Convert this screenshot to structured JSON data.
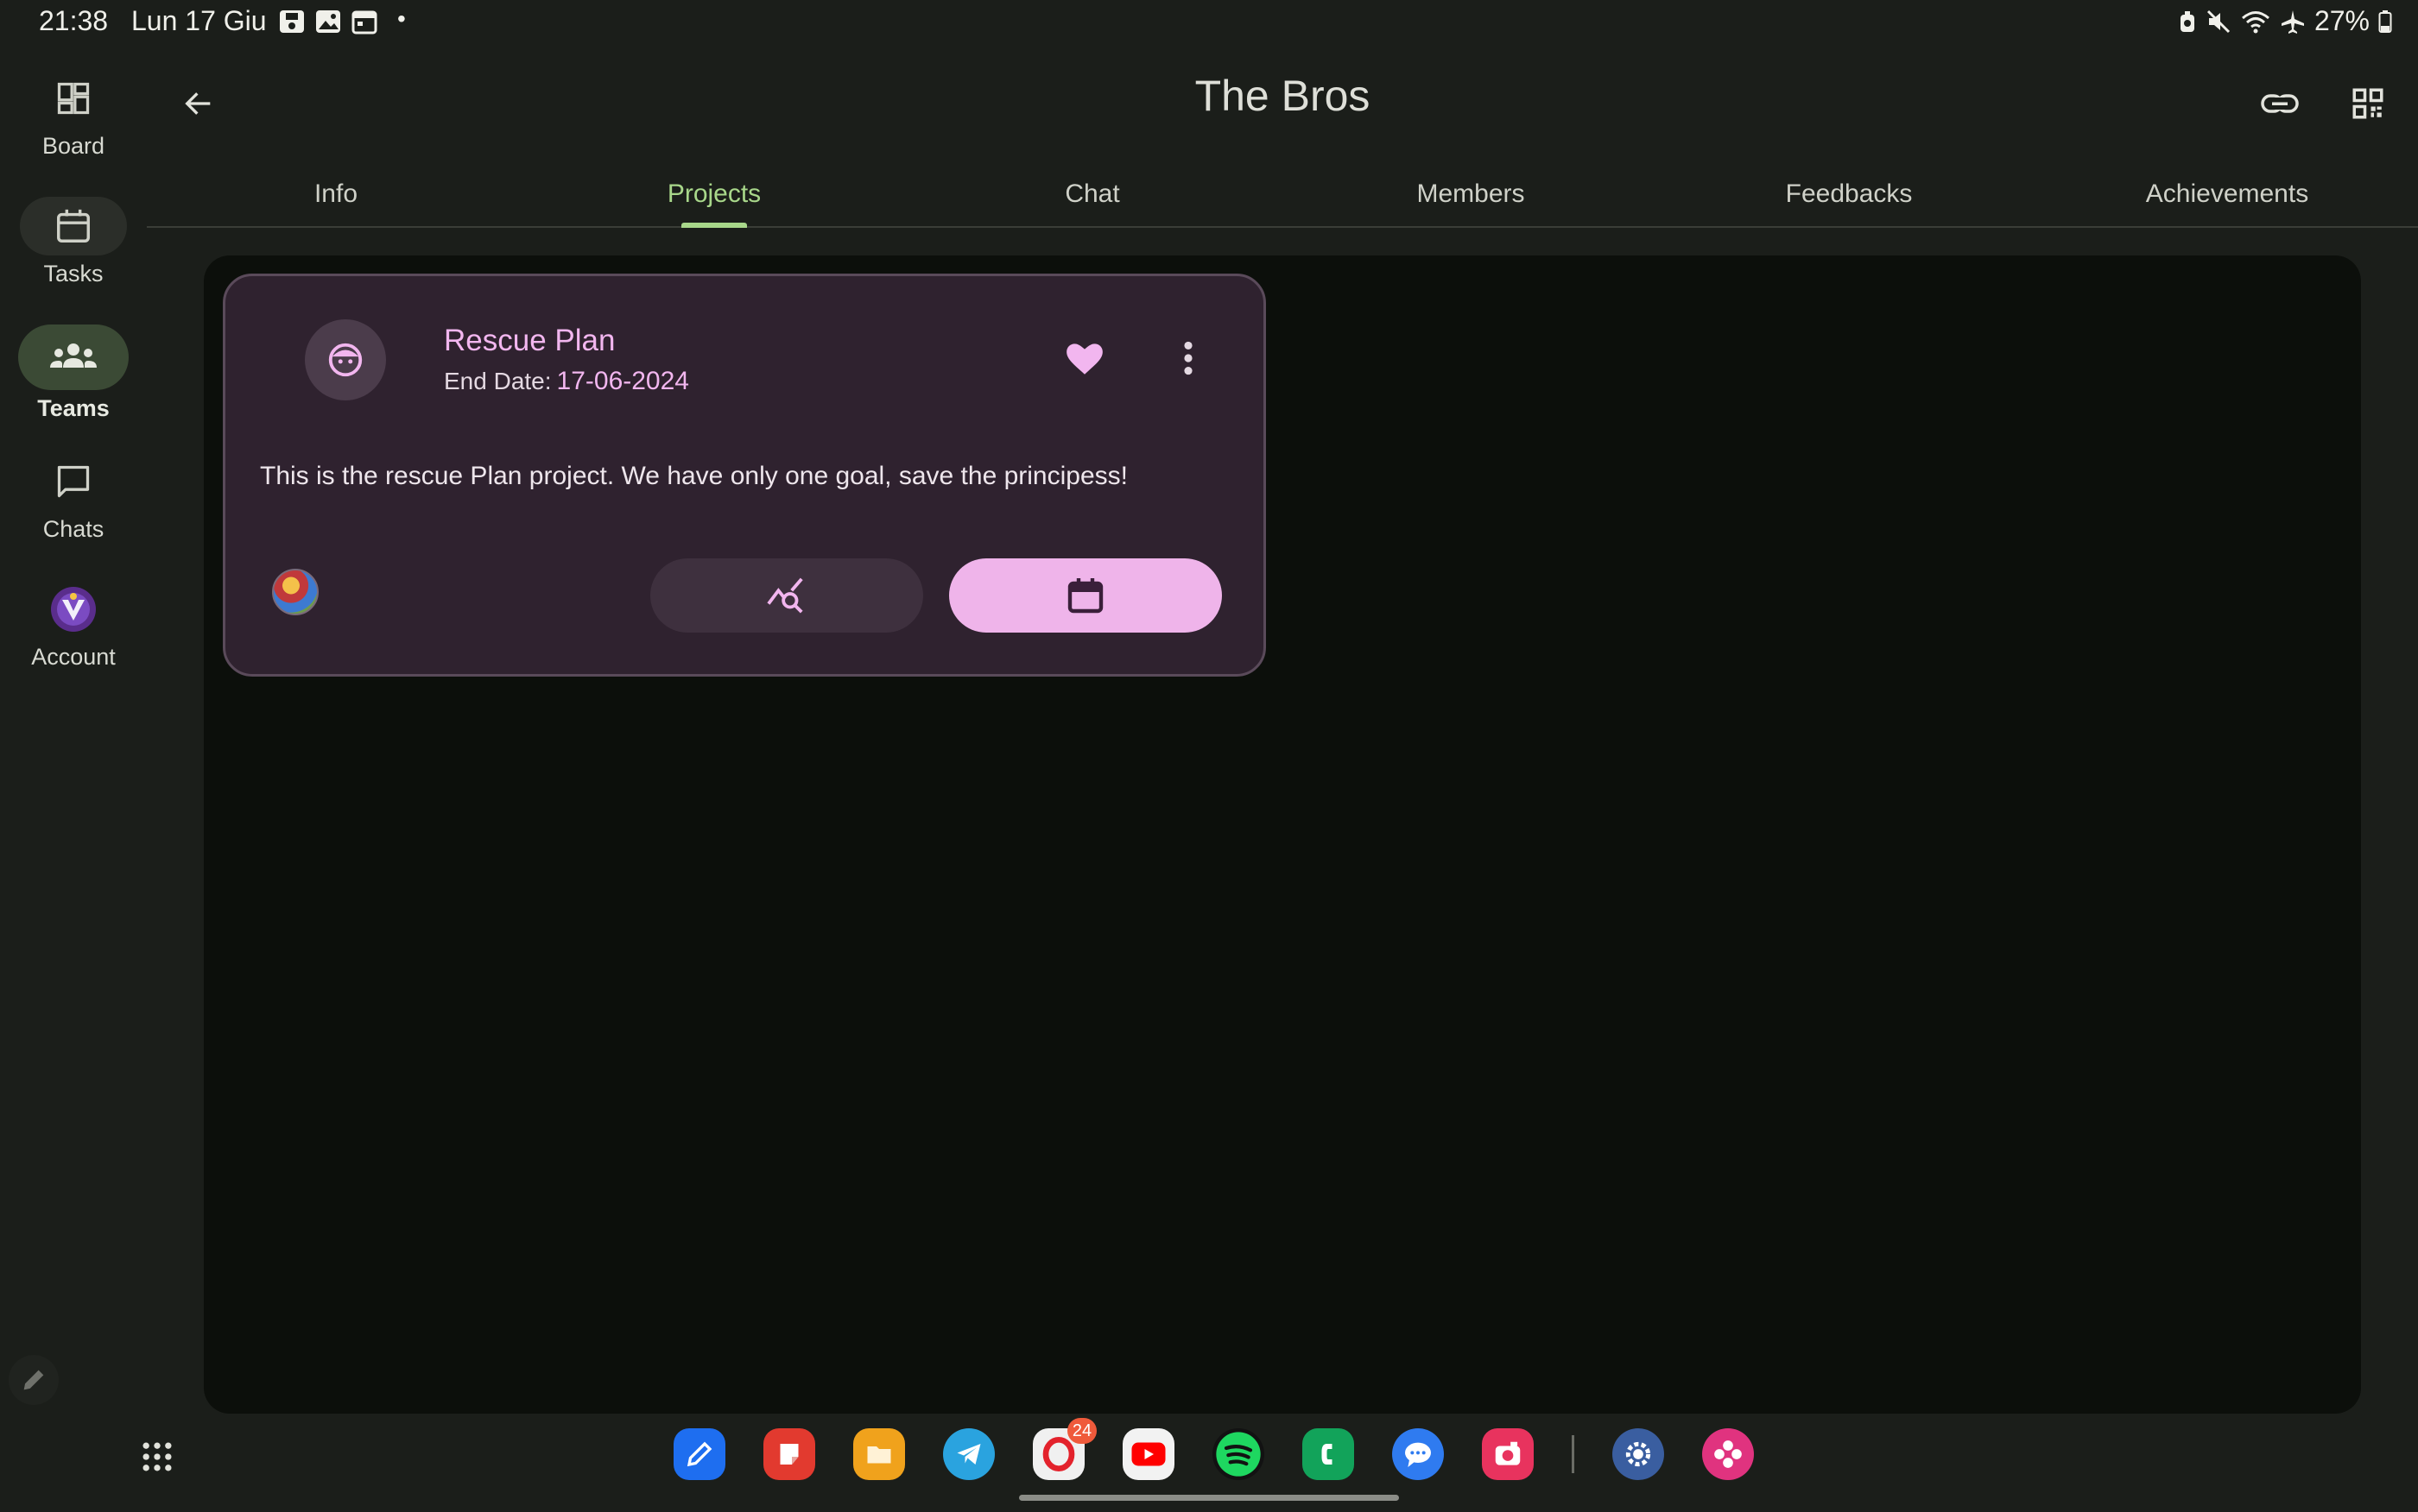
{
  "status_bar": {
    "time": "21:38",
    "date": "Lun 17 Giu",
    "left_icons": [
      "notification-save-icon",
      "notification-image-icon",
      "notification-calendar-icon"
    ],
    "dot": "•",
    "right_icons": [
      "alarm-icon",
      "mute-icon",
      "wifi-icon",
      "airplane-icon"
    ],
    "battery": "27%"
  },
  "nav_rail": {
    "items": [
      {
        "label": "Board",
        "icon": "dashboard-icon",
        "active": false
      },
      {
        "label": "Tasks",
        "icon": "calendar-icon",
        "active": false
      },
      {
        "label": "Teams",
        "icon": "groups-icon",
        "active": true
      },
      {
        "label": "Chats",
        "icon": "chat-icon",
        "active": false
      },
      {
        "label": "Account",
        "icon": "account-avatar",
        "active": false
      }
    ]
  },
  "header": {
    "title": "The Bros",
    "back_icon": "arrow-back-icon",
    "actions": [
      "link-icon",
      "qr-code-icon"
    ]
  },
  "tabs": [
    {
      "label": "Info",
      "active": false
    },
    {
      "label": "Projects",
      "active": true
    },
    {
      "label": "Chat",
      "active": false
    },
    {
      "label": "Members",
      "active": false
    },
    {
      "label": "Feedbacks",
      "active": false
    },
    {
      "label": "Achievements",
      "active": false
    }
  ],
  "project_card": {
    "title": "Rescue Plan",
    "end_date_label": "End Date:",
    "end_date": "17-06-2024",
    "description": "This is the rescue Plan project. We have only one goal, save the principess!",
    "favorite": true,
    "colors": {
      "accent": "#efb4ea",
      "card_bg": "#2f222f"
    }
  },
  "taskbar": {
    "apps": [
      {
        "name": "pen-app-icon",
        "color": "#1e6ef0"
      },
      {
        "name": "notes-app-icon",
        "color": "#e23a2f"
      },
      {
        "name": "files-app-icon",
        "color": "#f0a21c"
      },
      {
        "name": "telegram-app-icon",
        "color": "#2aa3df"
      },
      {
        "name": "opera-app-icon",
        "color": "#e8e8e8",
        "badge": "24"
      },
      {
        "name": "youtube-app-icon",
        "color": "#f2f2f2"
      },
      {
        "name": "spotify-app-icon",
        "color": "#121212"
      },
      {
        "name": "phone-app-icon",
        "color": "#12a35a"
      },
      {
        "name": "messages-app-icon",
        "color": "#2f7bf0"
      },
      {
        "name": "camera-app-icon",
        "color": "#e8335e"
      },
      {
        "name": "settings-app-icon",
        "color": "#3a5ea0"
      },
      {
        "name": "flower-app-icon",
        "color": "#e0337f"
      }
    ]
  }
}
